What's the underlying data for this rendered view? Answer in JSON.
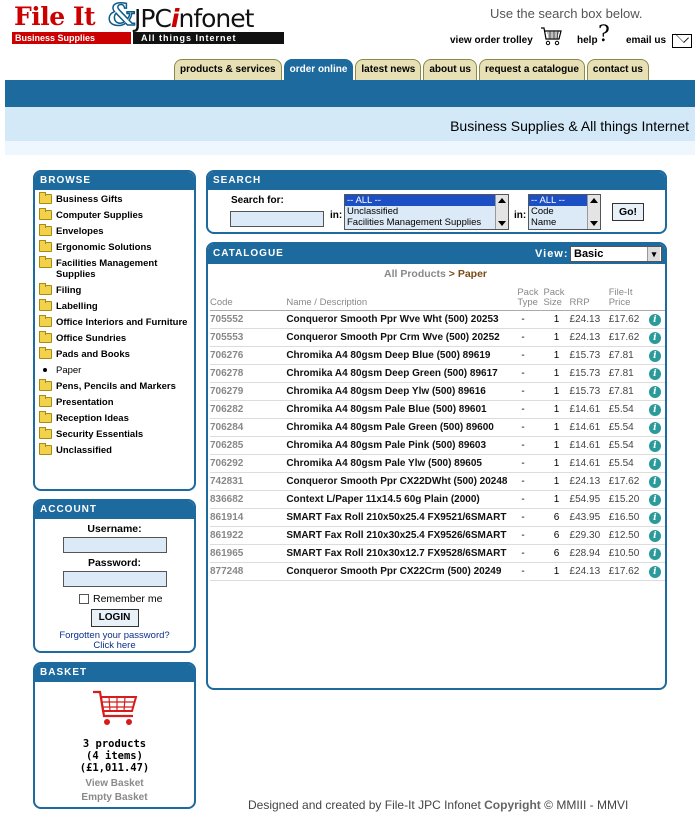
{
  "logo": {
    "file_it": "File It",
    "amp": "&",
    "jpc_prefix": "JPC",
    "jpc_i": "i",
    "jpc_suffix": "nfonet",
    "tag_left": "Business Supplies",
    "tag_right": "All things Internet"
  },
  "header": {
    "search_hint": "Use the search box below.",
    "view_trolley": "view order trolley",
    "help": "help",
    "email": "email us"
  },
  "tabs": [
    {
      "label": "products & services",
      "active": false
    },
    {
      "label": "order online",
      "active": true
    },
    {
      "label": "latest news",
      "active": false
    },
    {
      "label": "about us",
      "active": false
    },
    {
      "label": "request a catalogue",
      "active": false
    },
    {
      "label": "contact us",
      "active": false
    }
  ],
  "tagline": "Business Supplies & All things Internet",
  "browse": {
    "title": "BROWSE",
    "items": [
      {
        "label": "Business Gifts",
        "current": false
      },
      {
        "label": "Computer Supplies",
        "current": false
      },
      {
        "label": "Envelopes",
        "current": false
      },
      {
        "label": "Ergonomic Solutions",
        "current": false
      },
      {
        "label": "Facilities Management Supplies",
        "current": false
      },
      {
        "label": "Filing",
        "current": false
      },
      {
        "label": "Labelling",
        "current": false
      },
      {
        "label": "Office Interiors and Furniture",
        "current": false
      },
      {
        "label": "Office Sundries",
        "current": false
      },
      {
        "label": "Pads and Books",
        "current": false
      },
      {
        "label": "Paper",
        "current": true
      },
      {
        "label": "Pens, Pencils and Markers",
        "current": false
      },
      {
        "label": "Presentation",
        "current": false
      },
      {
        "label": "Reception Ideas",
        "current": false
      },
      {
        "label": "Security Essentials",
        "current": false
      },
      {
        "label": "Unclassified",
        "current": false
      }
    ]
  },
  "account": {
    "title": "ACCOUNT",
    "username_label": "Username:",
    "password_label": "Password:",
    "remember": "Remember me",
    "login": "LOGIN",
    "forgot_line1": "Forgotten your password?",
    "forgot_line2": "Click here"
  },
  "basket": {
    "title": "BASKET",
    "products": "3 products",
    "items": "(4 items)",
    "total": "(£1,011.47)",
    "view": "View Basket",
    "empty": "Empty Basket"
  },
  "search": {
    "title": "SEARCH",
    "search_for": "Search for:",
    "in_label": "in:",
    "category_options": [
      "-- ALL --",
      "Unclassified",
      "Facilities Management Supplies"
    ],
    "field_options": [
      "-- ALL --",
      "Code",
      "Name"
    ],
    "go": "Go!"
  },
  "catalogue": {
    "title": "CATALOGUE",
    "view_label": "View:",
    "view_value": "Basic",
    "crumb_root": "All Products",
    "crumb_sep": ">",
    "crumb_current": "Paper",
    "columns": {
      "code": "Code",
      "name": "Name / Description",
      "pack_type_1": "Pack",
      "pack_type_2": "Type",
      "pack_size_1": "Pack",
      "pack_size_2": "Size",
      "rrp": "RRP",
      "price_1": "File-It",
      "price_2": "Price"
    },
    "rows": [
      {
        "code": "705552",
        "name": "Conqueror Smooth Ppr Wve Wht (500) 20253",
        "type": "-",
        "size": "1",
        "rrp": "£24.13",
        "price": "£17.62"
      },
      {
        "code": "705553",
        "name": "Conqueror Smooth Ppr Crm Wve (500) 20252",
        "type": "-",
        "size": "1",
        "rrp": "£24.13",
        "price": "£17.62"
      },
      {
        "code": "706276",
        "name": "Chromika A4 80gsm Deep Blue (500) 89619",
        "type": "-",
        "size": "1",
        "rrp": "£15.73",
        "price": "£7.81"
      },
      {
        "code": "706278",
        "name": "Chromika A4 80gsm Deep Green (500) 89617",
        "type": "-",
        "size": "1",
        "rrp": "£15.73",
        "price": "£7.81"
      },
      {
        "code": "706279",
        "name": "Chromika A4 80gsm Deep Ylw (500) 89616",
        "type": "-",
        "size": "1",
        "rrp": "£15.73",
        "price": "£7.81"
      },
      {
        "code": "706282",
        "name": "Chromika A4 80gsm Pale Blue (500) 89601",
        "type": "-",
        "size": "1",
        "rrp": "£14.61",
        "price": "£5.54"
      },
      {
        "code": "706284",
        "name": "Chromika A4 80gsm Pale Green (500) 89600",
        "type": "-",
        "size": "1",
        "rrp": "£14.61",
        "price": "£5.54"
      },
      {
        "code": "706285",
        "name": "Chromika A4 80gsm Pale Pink (500) 89603",
        "type": "-",
        "size": "1",
        "rrp": "£14.61",
        "price": "£5.54"
      },
      {
        "code": "706292",
        "name": "Chromika A4 80gsm Pale Ylw (500) 89605",
        "type": "-",
        "size": "1",
        "rrp": "£14.61",
        "price": "£5.54"
      },
      {
        "code": "742831",
        "name": "Conqueror Smooth Ppr CX22DWht (500) 20248",
        "type": "-",
        "size": "1",
        "rrp": "£24.13",
        "price": "£17.62"
      },
      {
        "code": "836682",
        "name": "Context L/Paper 11x14.5 60g Plain (2000)",
        "type": "-",
        "size": "1",
        "rrp": "£54.95",
        "price": "£15.20"
      },
      {
        "code": "861914",
        "name": "SMART Fax Roll 210x50x25.4 FX9521/6SMART",
        "type": "-",
        "size": "6",
        "rrp": "£43.95",
        "price": "£16.50"
      },
      {
        "code": "861922",
        "name": "SMART Fax Roll 210x30x25.4 FX9526/6SMART",
        "type": "-",
        "size": "6",
        "rrp": "£29.30",
        "price": "£12.50"
      },
      {
        "code": "861965",
        "name": "SMART Fax Roll 210x30x12.7 FX9528/6SMART",
        "type": "-",
        "size": "6",
        "rrp": "£28.94",
        "price": "£10.50"
      },
      {
        "code": "877248",
        "name": "Conqueror Smooth Ppr CX22Crm (500) 20249",
        "type": "-",
        "size": "1",
        "rrp": "£24.13",
        "price": "£17.62"
      }
    ]
  },
  "footer": {
    "designed": "Designed and created by File-It JPC Infonet",
    "copyright": "Copyright",
    "years": "© MMIII - MMVI"
  },
  "colors": {
    "brand_blue": "#1d6a9e",
    "brand_red": "#cc0000",
    "tab_bg": "#e6e0b4",
    "input_bg": "#dce9f7"
  }
}
